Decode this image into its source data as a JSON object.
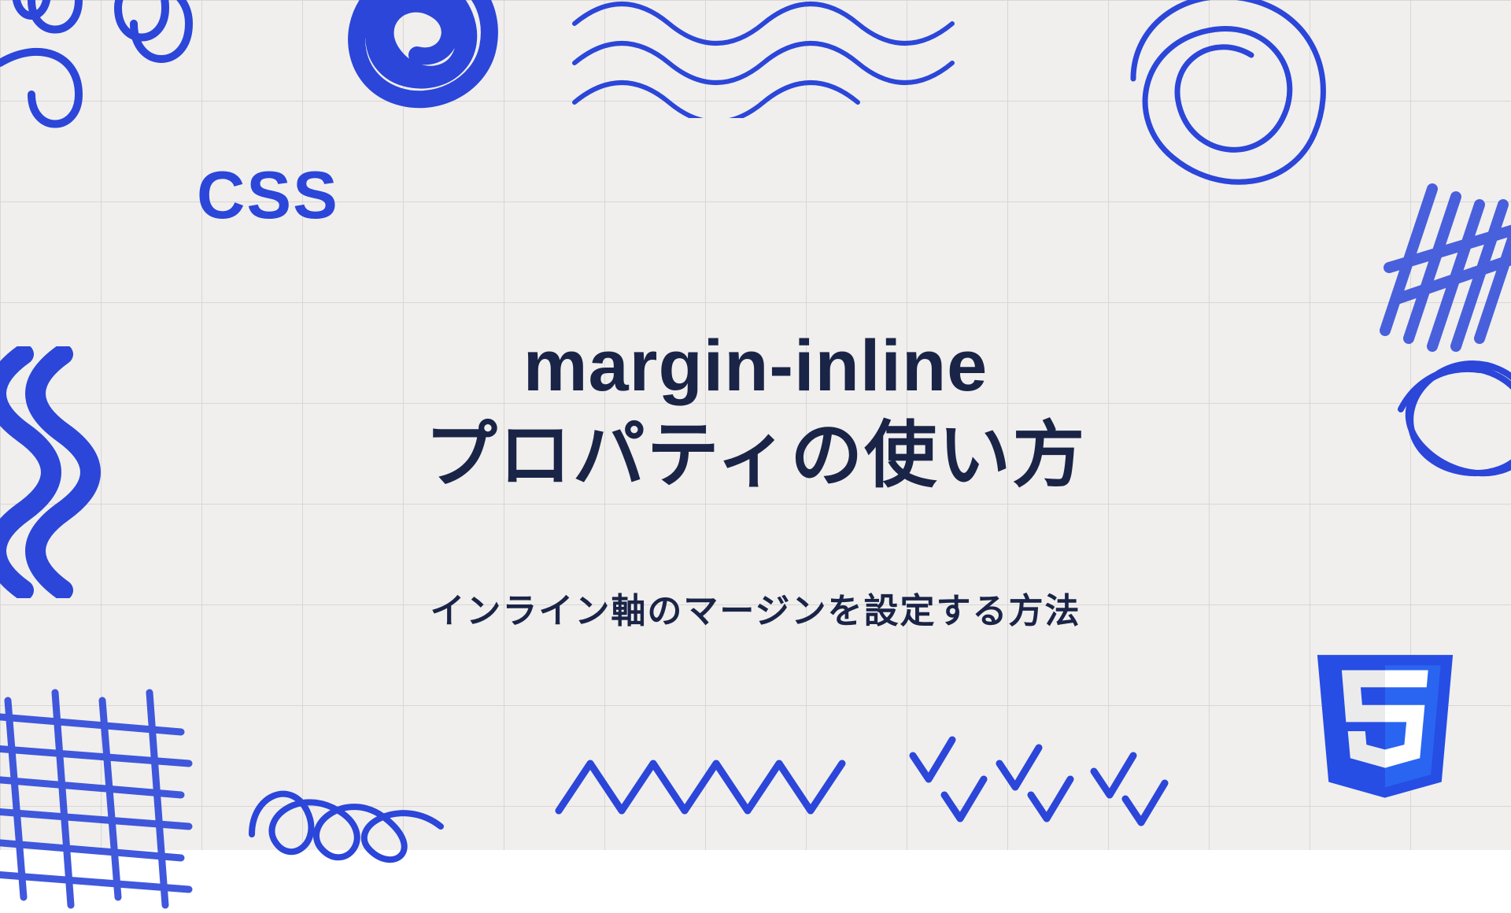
{
  "category": "CSS",
  "title_line1": "margin-inline",
  "title_line2": "プロパティの使い方",
  "subtitle": "インライン軸のマージンを設定する方法",
  "colors": {
    "primary_blue": "#2b46d8",
    "dark_navy": "#1a2447",
    "background": "#f0efed",
    "grid": "#d8d7d5",
    "css3_orange_dark": "#264de4",
    "css3_orange_light": "#2965f1"
  },
  "logo": {
    "type": "CSS3",
    "icon_name": "css3-shield-icon"
  }
}
